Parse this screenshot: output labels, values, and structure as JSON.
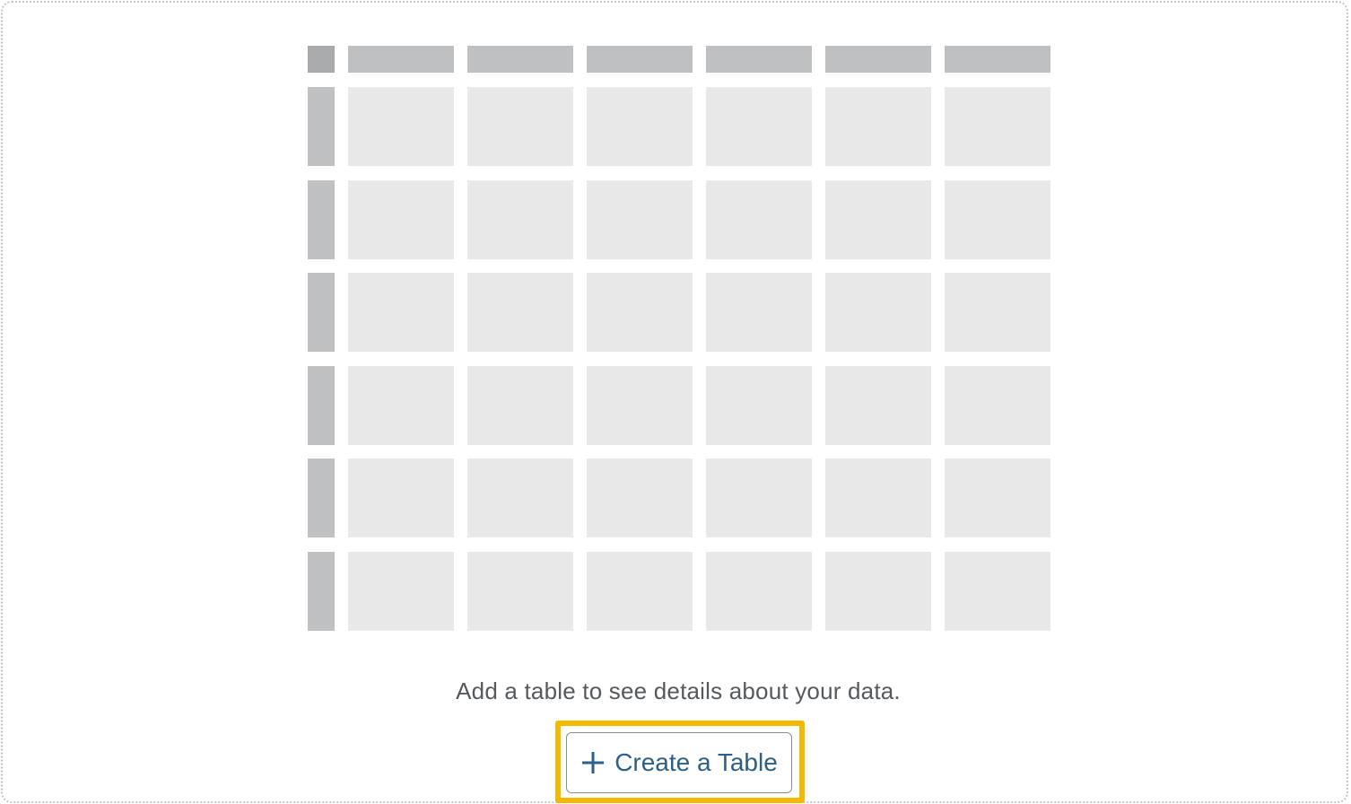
{
  "empty_state": {
    "message": "Add a table to see details about your data.",
    "create_button_label": "Create a Table",
    "create_button_icon": "plus-icon",
    "placeholder_table": {
      "columns": 6,
      "rows": 6
    }
  },
  "colors": {
    "accent_text": "#2c5f8a",
    "focus_ring": "#f5b800",
    "message_text": "#555a5f"
  }
}
